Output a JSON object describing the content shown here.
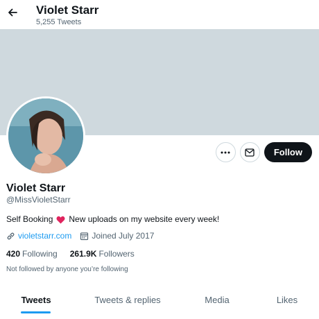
{
  "header": {
    "title": "Violet Starr",
    "tweet_count": "5,255 Tweets"
  },
  "profile": {
    "display_name": "Violet Starr",
    "handle": "@MissVioletStarr",
    "bio_before": "Self Booking",
    "bio_after": "New uploads on my website every week!",
    "website": "violetstarr.com",
    "joined": "Joined July 2017",
    "following_count": "420",
    "following_label": "Following",
    "followers_count": "261.9K",
    "followers_label": "Followers",
    "not_followed": "Not followed by anyone you’re following"
  },
  "actions": {
    "follow_label": "Follow"
  },
  "tabs": [
    {
      "label": "Tweets",
      "active": true
    },
    {
      "label": "Tweets & replies",
      "active": false
    },
    {
      "label": "Media",
      "active": false
    },
    {
      "label": "Likes",
      "active": false
    }
  ],
  "colors": {
    "accent": "#1d9bf0",
    "banner": "#cfd9de",
    "text": "#0f1419",
    "secondary": "#536471"
  },
  "icons": [
    "back-arrow-icon",
    "more-icon",
    "mail-icon",
    "heart-icon",
    "link-icon",
    "calendar-icon"
  ]
}
